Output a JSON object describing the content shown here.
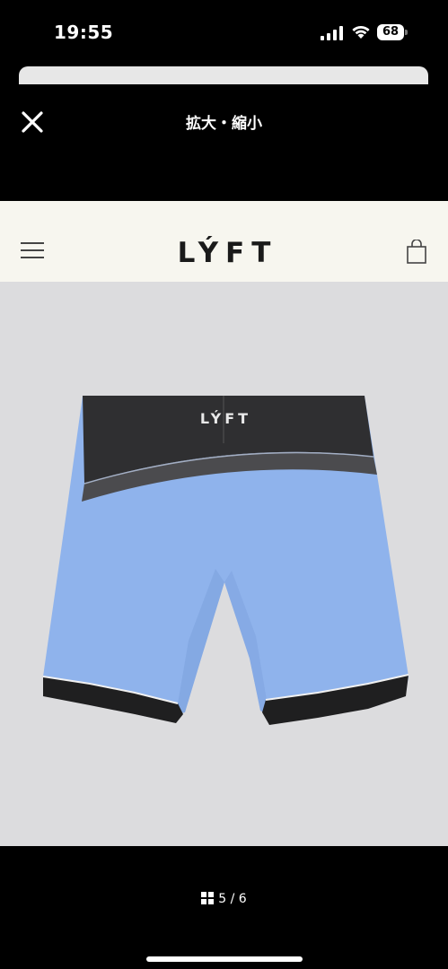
{
  "status_bar": {
    "time": "19:55",
    "battery_level": "68"
  },
  "viewer": {
    "title": "拡大・縮小",
    "close_icon": "close-icon",
    "page_indicator": "5 / 6",
    "grid_icon": "grid-icon"
  },
  "site_header": {
    "brand": "LÝFT",
    "menu_icon": "hamburger-menu-icon",
    "cart_icon": "shopping-bag-icon"
  },
  "product": {
    "logo_text": "LÝFT",
    "colors": {
      "body": "#8fb3ec",
      "waistband": "#2f2f31",
      "background": "#dcdcde"
    }
  }
}
